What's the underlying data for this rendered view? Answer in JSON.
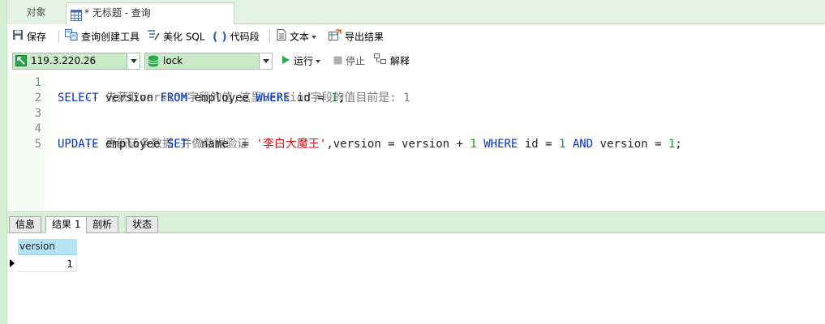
{
  "tabs": {
    "objects": "对象",
    "query": "* 无标题 - 查询"
  },
  "toolbar": {
    "save": "保存",
    "query_builder": "查询创建工具",
    "beautify_sql": "美化 SQL",
    "code_snippet": "代码段",
    "text": "文本",
    "export_results": "导出结果"
  },
  "connection": {
    "host": "119.3.220.26",
    "database": "lock"
  },
  "run_controls": {
    "run": "运行",
    "stop": "停止",
    "explain": "解释"
  },
  "editor": {
    "line_numbers": [
      "1",
      "2",
      "3",
      "4",
      "5"
    ],
    "line1": {
      "comment": "-- 先获取version字段的值,这里version字段的值目前是: 1"
    },
    "line2": {
      "kw1": "SELECT",
      "t1": " version ",
      "kw2": "FROM",
      "t2": " employee ",
      "kw3": "WHERE",
      "t3": " id = ",
      "n1": "1",
      "t4": ";"
    },
    "line4": {
      "comment": "-- 更新该条数据 并做数据验证"
    },
    "line5": {
      "kw1": "UPDATE",
      "t1": " employee ",
      "kw2": "SET",
      "t2": " `name` = ",
      "s1": "'李白大魔王'",
      "t3": ",version = version + ",
      "n1": "1",
      "t4": " ",
      "kw3": "WHERE",
      "t5": " id = ",
      "n2": "1",
      "t6": " ",
      "kw4": "AND",
      "t7": " version = ",
      "n3": "1",
      "t8": ";"
    }
  },
  "result_tabs": [
    "信息",
    "结果 1",
    "剖析",
    "状态"
  ],
  "grid": {
    "column": "version",
    "rows": [
      [
        "1"
      ]
    ]
  },
  "colors": {
    "keyword": "#0033cc",
    "number": "#0b9a3a",
    "string": "#d4101a",
    "comment": "#808080",
    "combo_bg": "#c9e9c9",
    "header_bg": "#b3e3f4"
  }
}
